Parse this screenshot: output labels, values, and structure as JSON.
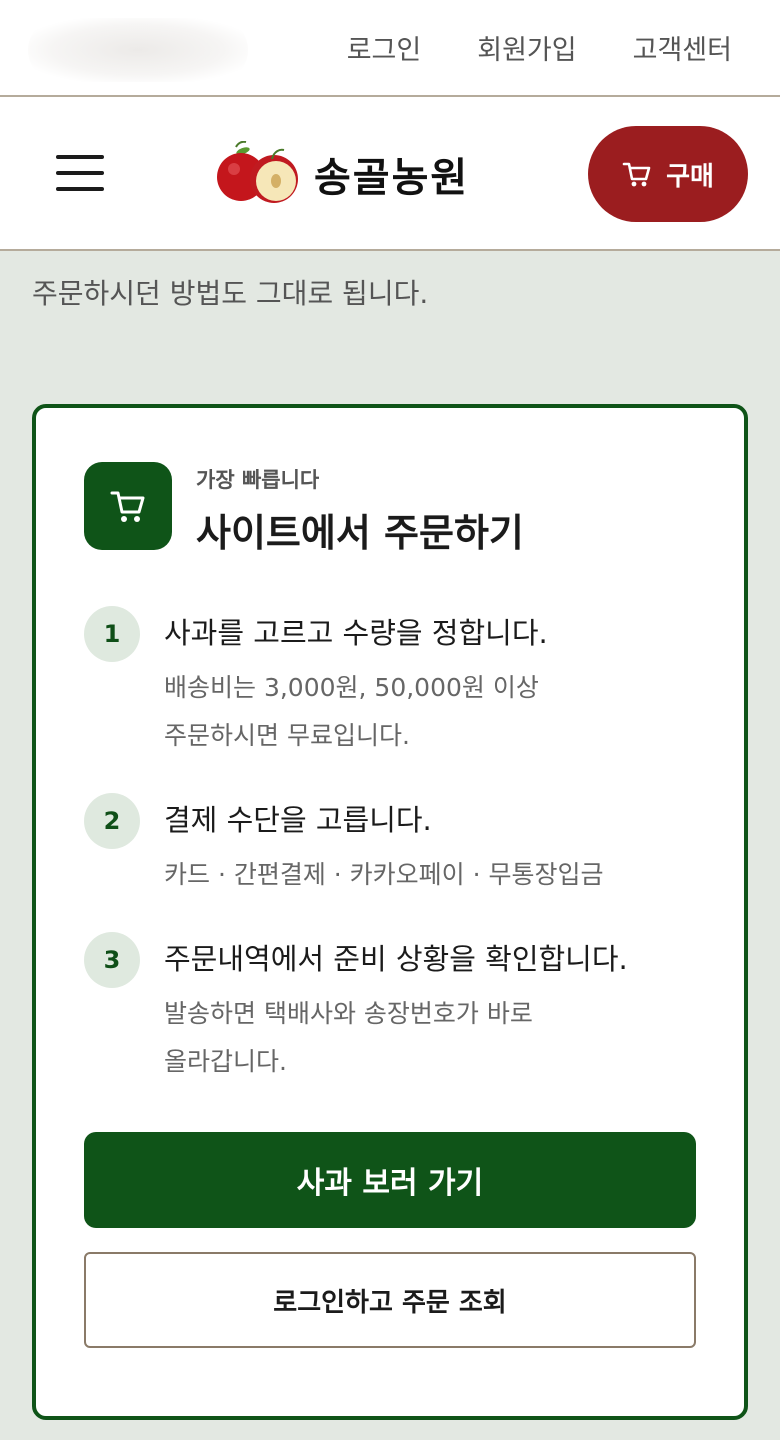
{
  "topbar": {
    "links": [
      "로그인",
      "회원가입",
      "고객센터"
    ]
  },
  "header": {
    "menu_icon": "hamburger-menu-icon",
    "logo_icon": "apple-logo-icon",
    "logo_text": "송골농원",
    "buy_icon": "cart-icon",
    "buy_label": "구매"
  },
  "intro": {
    "text": "주문하시던 방법도 그대로 됩니다."
  },
  "card": {
    "icon": "cart-icon",
    "kicker": "가장 빠릅니다",
    "title": "사이트에서 주문하기",
    "steps": [
      {
        "num": "1",
        "title": "사과를 고르고 수량을 정합니다.",
        "desc": [
          "배송비는 3,000원, 50,000원 이상",
          "주문하시면 무료입니다."
        ]
      },
      {
        "num": "2",
        "title": "결제 수단을 고릅니다.",
        "desc": [
          "카드 · 간편결제 · 카카오페이 · 무통장입금"
        ]
      },
      {
        "num": "3",
        "title": "주문내역에서 준비 상황을 확인합니다.",
        "desc": [
          "발송하면 택배사와 송장번호가 바로",
          "올라갑니다."
        ]
      }
    ],
    "primary_button": "사과 보러 가기",
    "secondary_button": "로그인하고 주문 조회"
  },
  "colors": {
    "brand_green": "#0f5418",
    "buy_red": "#9b1d1f",
    "background": "#e3e8e2",
    "step_badge": "#dfe9df"
  }
}
